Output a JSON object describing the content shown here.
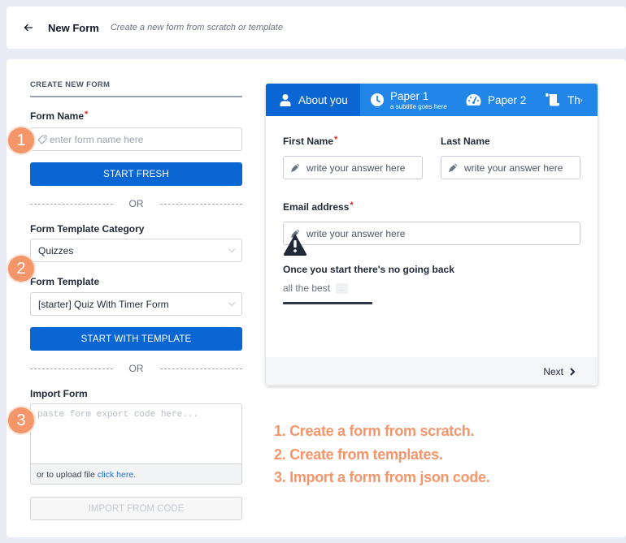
{
  "header": {
    "back_icon": "arrow-left-icon",
    "title": "New Form",
    "subtitle": "Create a new form from scratch or template"
  },
  "create": {
    "section_title": "CREATE NEW FORM",
    "form_name_label": "Form Name",
    "required_mark": "*",
    "form_name_placeholder": "enter form name here",
    "form_name_icon": "tag-icon",
    "start_fresh": "START FRESH",
    "or_label": "OR",
    "category_label": "Form Template Category",
    "category_value": "Quizzes",
    "template_label": "Form Template",
    "template_value": "[starter] Quiz With Timer Form",
    "start_template": "START WITH TEMPLATE",
    "import_label": "Import Form",
    "import_placeholder": "paste form export code here...",
    "upload_text": "or to upload file",
    "upload_link": "click here.",
    "import_button": "IMPORT FROM CODE"
  },
  "badges": [
    "1",
    "2",
    "3"
  ],
  "preview": {
    "tabs": [
      {
        "label": "About you",
        "icon": "user-icon",
        "active": true
      },
      {
        "label": "Paper 1",
        "subtitle": "a subtitle goes here",
        "icon": "clock-icon"
      },
      {
        "label": "Paper 2",
        "icon": "gauge-icon"
      },
      {
        "label": "Th",
        "icon": "scroll-icon"
      }
    ],
    "first_name_label": "First Name",
    "last_name_label": "Last Name",
    "email_label": "Email address",
    "required_mark": "*",
    "input_placeholder": "write your answer here",
    "warning_title": "Once you start there's no going back",
    "warning_subtitle": "all the best",
    "ellipsis": "...",
    "next_label": "Next"
  },
  "notes": [
    "1. Create a form from scratch.",
    "2. Create from templates.",
    "3. Import a form from json code."
  ],
  "colors": {
    "primary": "#0a66d2",
    "tab_bar": "#2186e8",
    "accent_orange": "#f4956a",
    "required": "#dc2626"
  }
}
